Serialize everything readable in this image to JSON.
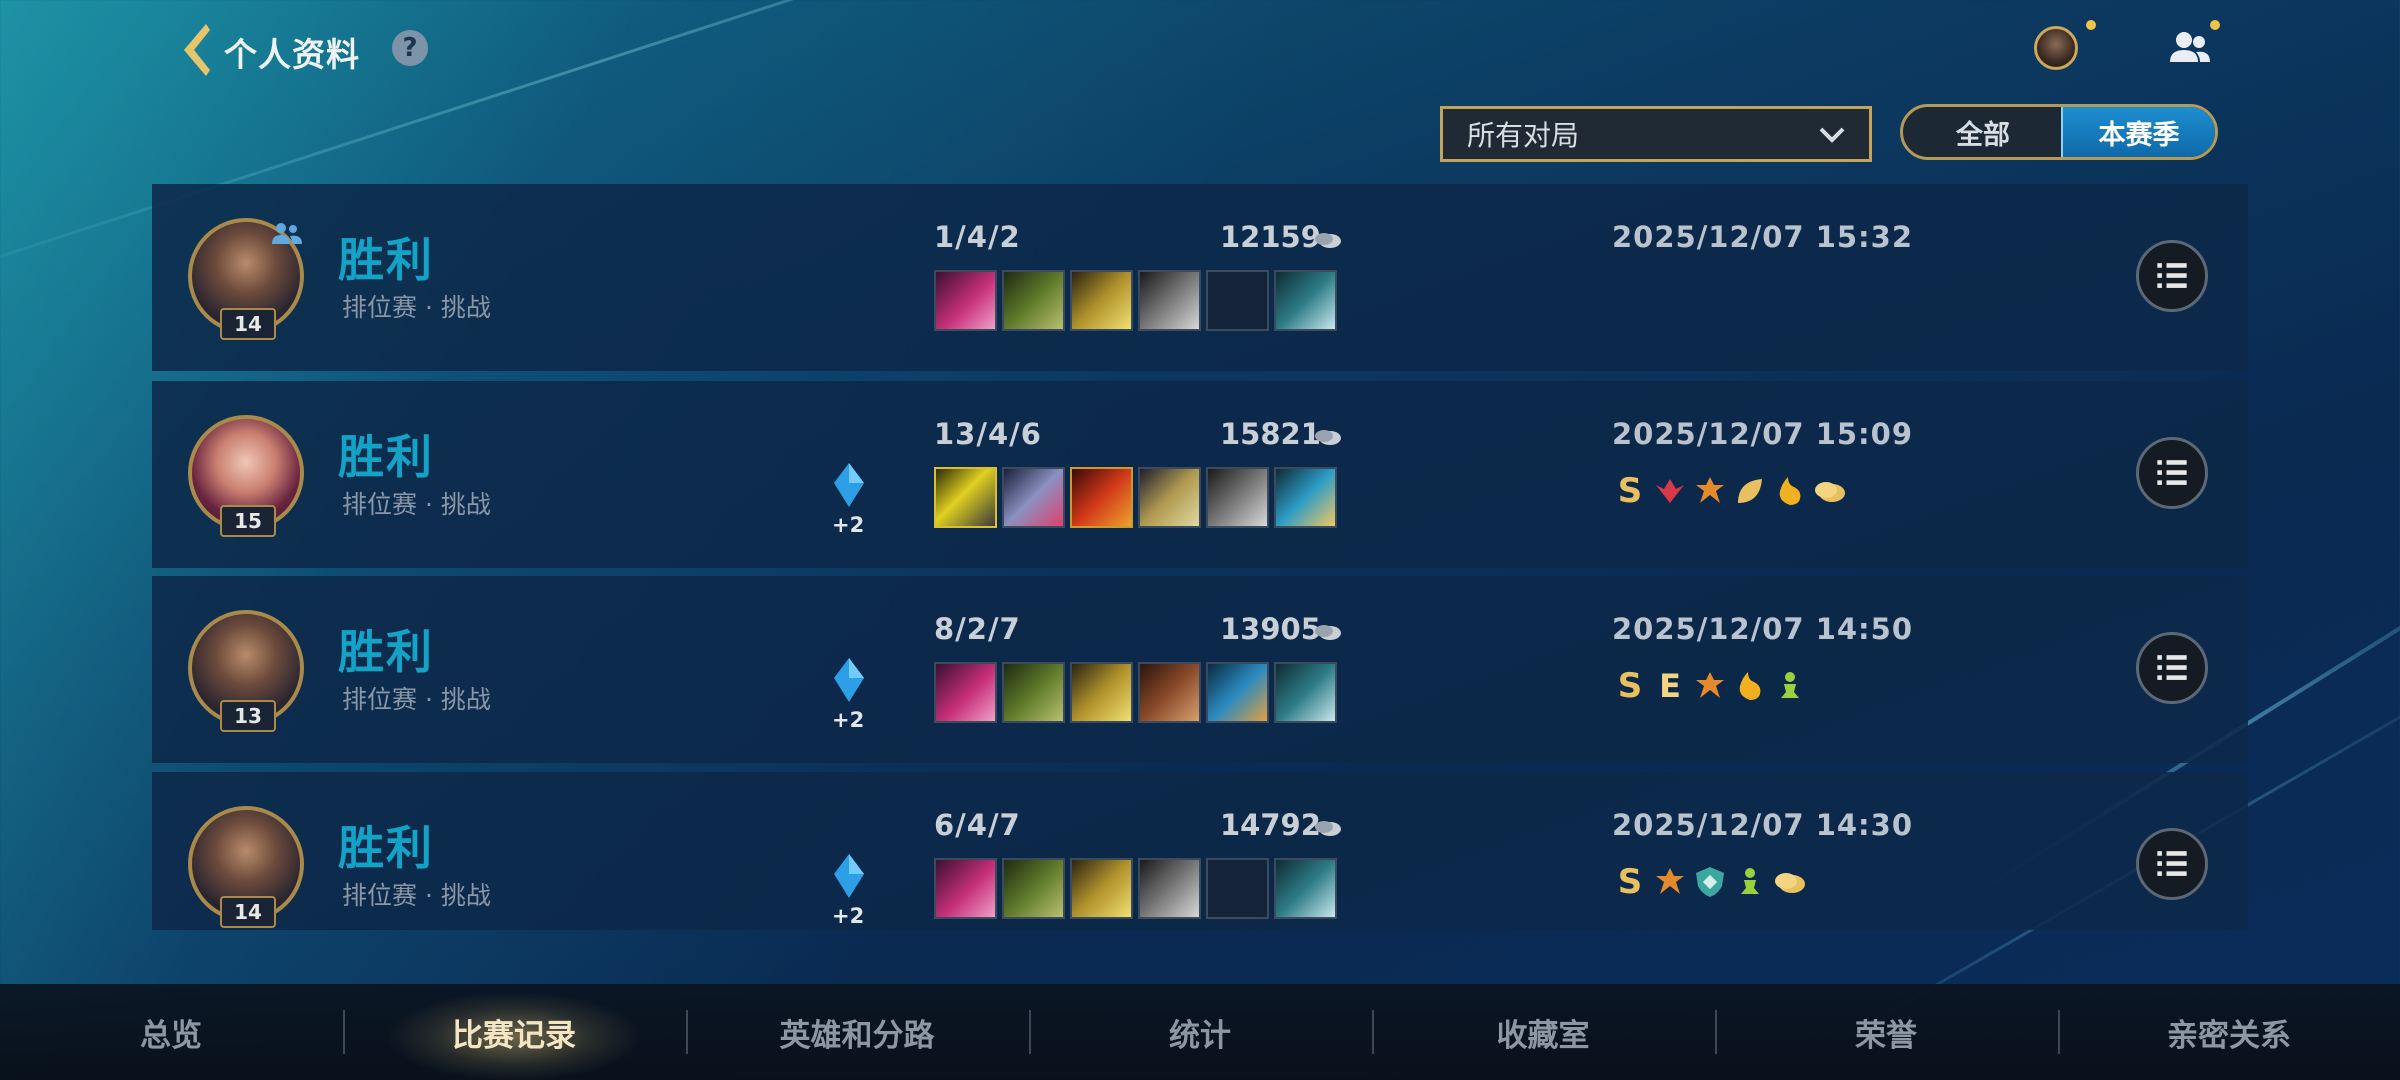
{
  "header": {
    "title": "个人资料",
    "help_label": "?"
  },
  "filters": {
    "match_type": "所有对局",
    "scope_all": "全部",
    "scope_season": "本赛季",
    "selected_scope": "本赛季"
  },
  "matches": [
    {
      "result": "胜利",
      "mode": "排位赛 · 挑战",
      "level": "14",
      "champion": "yasuo",
      "party": true,
      "lp_gain": "",
      "kda": "1/4/2",
      "gold": "12159",
      "datetime": "2025/12/07 15:32",
      "items": [
        "pink-blade",
        "green-scythe",
        "gold-blade",
        "steel-sword",
        "empty",
        "trinket-blade"
      ],
      "badges": []
    },
    {
      "result": "胜利",
      "mode": "排位赛 · 挑战",
      "level": "15",
      "champion": "fiora",
      "party": false,
      "lp_gain": "+2",
      "kda": "13/4/6",
      "gold": "15821",
      "datetime": "2025/12/07 15:09",
      "items": [
        "yellow-triangle",
        "axe-pink",
        "fire-blade",
        "star-blade",
        "steel-sword",
        "trinket-gold"
      ],
      "badges": [
        "S",
        "red-wings-icon",
        "orange-crest-icon",
        "gold-leaf-icon",
        "flame-icon",
        "gold-coin-icon"
      ]
    },
    {
      "result": "胜利",
      "mode": "排位赛 · 挑战",
      "level": "13",
      "champion": "yasuo",
      "party": false,
      "lp_gain": "+2",
      "kda": "8/2/7",
      "gold": "13905",
      "datetime": "2025/12/07 14:50",
      "items": [
        "pink-blade",
        "green-scythe",
        "gold-blade",
        "hammer",
        "blue-scale",
        "trinket-blade"
      ],
      "badges": [
        "S",
        "E",
        "orange-crest-icon",
        "flame-icon",
        "green-chess-icon"
      ]
    },
    {
      "result": "胜利",
      "mode": "排位赛 · 挑战",
      "level": "14",
      "champion": "yasuo",
      "party": false,
      "lp_gain": "+2",
      "kda": "6/4/7",
      "gold": "14792",
      "datetime": "2025/12/07 14:30",
      "items": [
        "pink-blade",
        "green-scythe",
        "gold-blade",
        "steel-sword",
        "empty",
        "trinket-blade"
      ],
      "badges": [
        "S",
        "orange-crest-icon",
        "teal-shield-icon",
        "green-chess-icon",
        "gold-coin-icon"
      ]
    }
  ],
  "tabs": [
    {
      "label": "总览",
      "active": false
    },
    {
      "label": "比赛记录",
      "active": true
    },
    {
      "label": "英雄和分路",
      "active": false
    },
    {
      "label": "统计",
      "active": false
    },
    {
      "label": "收藏室",
      "active": false
    },
    {
      "label": "荣誉",
      "active": false
    },
    {
      "label": "亲密关系",
      "active": false
    }
  ],
  "colors": {
    "result_win": "#13a3c6",
    "gold_accent": "#c3a45a",
    "toggle_active": "#1d8ed0"
  }
}
